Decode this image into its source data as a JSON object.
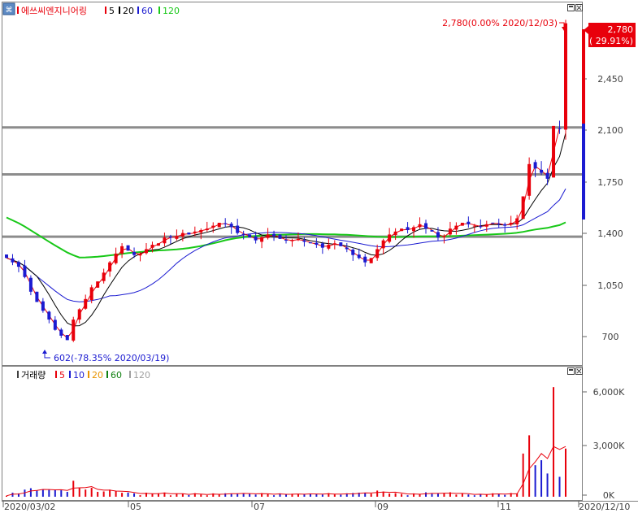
{
  "price_chart": {
    "legend": {
      "stock_name": "에쓰씨엔지니어링",
      "ma_items": [
        {
          "label": "5",
          "color": "#e8000b"
        },
        {
          "label": "20",
          "color": "#000000"
        },
        {
          "label": "60",
          "color": "#1b1bd1"
        },
        {
          "label": "120",
          "color": "#18c818"
        }
      ]
    },
    "price_ticks": [
      "2,450",
      "2,100",
      "1,750",
      "1,400",
      "1,050",
      "700"
    ],
    "last_price_badge": {
      "price": "2,780",
      "change": "( 29.91%)"
    },
    "high_annotation": "2,780(0.00% 2020/12/03)",
    "low_annotation": "602(-78.35% 2020/03/19)"
  },
  "volume_chart": {
    "legend": {
      "title": "거래량",
      "ma_items": [
        {
          "label": "5",
          "color": "#e8000b"
        },
        {
          "label": "10",
          "color": "#1b1bd1"
        },
        {
          "label": "20",
          "color": "#e89400"
        },
        {
          "label": "60",
          "color": "#108010"
        },
        {
          "label": "120",
          "color": "#a0a0a0"
        }
      ]
    },
    "volume_ticks": [
      "6,000K",
      "3,000K",
      "0K"
    ]
  },
  "x_labels": [
    "2020/03/02",
    "05",
    "07",
    "09",
    "11",
    "2020/12/10"
  ],
  "chart_data": {
    "type": "candlestick",
    "period": [
      "2020/03/02",
      "2020/12/10"
    ],
    "price": {
      "ylim": [
        500,
        2800
      ],
      "horizontal_lines": [
        2070,
        1750,
        1325
      ],
      "high": {
        "value": 2780,
        "date": "2020/12/03"
      },
      "low": {
        "value": 602,
        "date": "2020/03/19"
      },
      "last_close": 2780,
      "last_change_pct": 29.91,
      "close_series": [
        1180,
        1150,
        1120,
        1050,
        950,
        880,
        820,
        760,
        690,
        650,
        620,
        760,
        830,
        900,
        980,
        1020,
        1080,
        1150,
        1210,
        1260,
        1230,
        1200,
        1210,
        1240,
        1270,
        1280,
        1320,
        1320,
        1330,
        1350,
        1340,
        1360,
        1370,
        1380,
        1400,
        1420,
        1410,
        1390,
        1350,
        1340,
        1320,
        1300,
        1320,
        1340,
        1330,
        1310,
        1300,
        1300,
        1310,
        1290,
        1280,
        1270,
        1250,
        1270,
        1280,
        1260,
        1240,
        1200,
        1180,
        1150,
        1180,
        1240,
        1300,
        1340,
        1360,
        1380,
        1370,
        1390,
        1410,
        1380,
        1360,
        1320,
        1330,
        1380,
        1400,
        1420,
        1410,
        1400,
        1390,
        1410,
        1420,
        1410,
        1400,
        1420,
        1450,
        1600,
        1820,
        1790,
        1760,
        1720,
        2080,
        2060,
        2780
      ]
    },
    "volume": {
      "ylim": [
        0,
        7000000
      ]
    }
  }
}
